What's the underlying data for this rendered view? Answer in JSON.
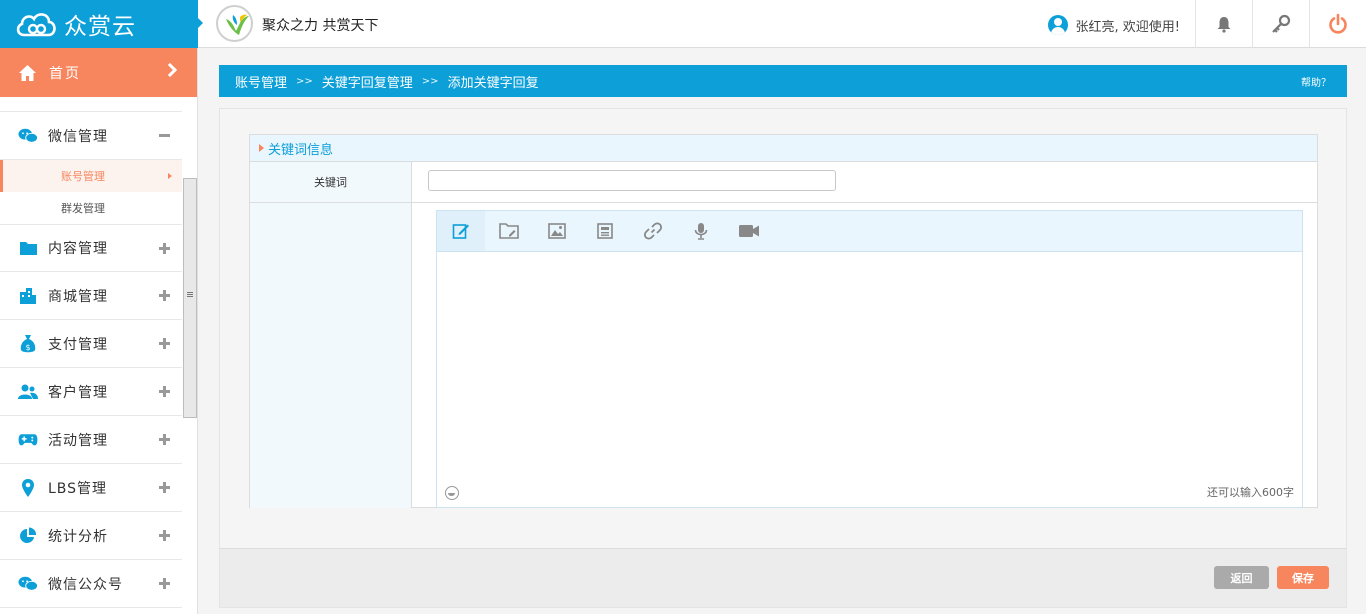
{
  "brand": {
    "name": "众赏云",
    "slogan": "聚众之力 共赏天下",
    "accent": "#0c9fd8",
    "orange": "#f7865f"
  },
  "header": {
    "user_text": "张红亮, 欢迎使用!",
    "icons": [
      "bell-icon",
      "key-icon",
      "power-icon"
    ]
  },
  "sidebar": {
    "home": {
      "label": "首页",
      "icon": "home-icon"
    },
    "items": [
      {
        "label": "微信管理",
        "icon": "wechat-icon",
        "expanded": true,
        "children": [
          {
            "label": "账号管理",
            "active": true
          },
          {
            "label": "群发管理"
          }
        ]
      },
      {
        "label": "内容管理",
        "icon": "folder-icon"
      },
      {
        "label": "商城管理",
        "icon": "building-icon"
      },
      {
        "label": "支付管理",
        "icon": "money-bag-icon"
      },
      {
        "label": "客户管理",
        "icon": "users-icon"
      },
      {
        "label": "活动管理",
        "icon": "gamepad-icon"
      },
      {
        "label": "LBS管理",
        "icon": "location-pin-icon"
      },
      {
        "label": "统计分析",
        "icon": "pie-chart-icon"
      },
      {
        "label": "微信公众号",
        "icon": "wechat-icon"
      }
    ]
  },
  "breadcrumb": {
    "items": [
      "账号管理",
      "关键字回复管理",
      "添加关键字回复"
    ],
    "separator": ">>",
    "help": "帮助？"
  },
  "form": {
    "section_title": "关键词信息",
    "keyword_label": "关键词",
    "keyword_value": "",
    "editor_tools": [
      "edit-icon",
      "folder-icon",
      "image-icon",
      "article-icon",
      "link-icon",
      "microphone-icon",
      "video-camera-icon"
    ],
    "remaining": "还可以输入600字"
  },
  "buttons": {
    "back": "返回",
    "save": "保存"
  }
}
